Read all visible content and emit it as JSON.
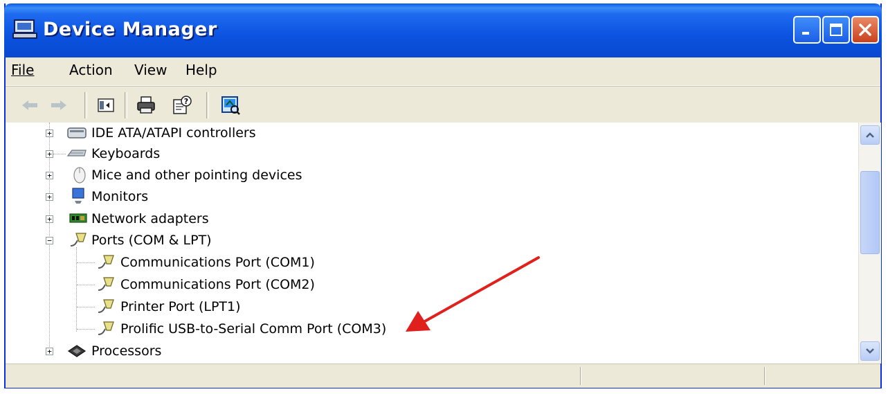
{
  "window": {
    "title": "Device Manager",
    "controls": {
      "minimize_icon": "minimize-icon",
      "maximize_icon": "maximize-icon",
      "close_icon": "close-icon"
    }
  },
  "menubar": {
    "items": [
      {
        "label": "File",
        "accesskey": "F"
      },
      {
        "label": "Action",
        "accesskey": "A"
      },
      {
        "label": "View",
        "accesskey": "V"
      },
      {
        "label": "Help",
        "accesskey": "H"
      }
    ]
  },
  "toolbar": {
    "items": [
      "back-arrow-icon",
      "forward-arrow-icon",
      "show-hide-console-tree-icon",
      "print-icon",
      "properties-help-icon",
      "scan-hardware-icon"
    ]
  },
  "tree": {
    "items": [
      {
        "label": "IDE ATA/ATAPI controllers",
        "icon": "ide-controller-icon",
        "expander": "+"
      },
      {
        "label": "Keyboards",
        "icon": "keyboard-icon",
        "expander": "+"
      },
      {
        "label": "Mice and other pointing devices",
        "icon": "mouse-icon",
        "expander": "+"
      },
      {
        "label": "Monitors",
        "icon": "monitor-icon",
        "expander": "+"
      },
      {
        "label": "Network adapters",
        "icon": "network-adapter-icon",
        "expander": "+"
      },
      {
        "label": "Ports (COM & LPT)",
        "icon": "port-icon",
        "expander": "−"
      },
      {
        "label": "Communications Port (COM1)",
        "icon": "port-icon"
      },
      {
        "label": "Communications Port (COM2)",
        "icon": "port-icon"
      },
      {
        "label": "Printer Port (LPT1)",
        "icon": "port-icon"
      },
      {
        "label": "Prolific USB-to-Serial Comm Port (COM3)",
        "icon": "port-icon"
      },
      {
        "label": "Processors",
        "icon": "processor-icon",
        "expander": "+"
      }
    ]
  },
  "annotation": {
    "arrow_color": "#e0201c"
  },
  "colors": {
    "titlebar": "#0b53e0",
    "chrome": "#ece9d8",
    "tree_bg": "#ffffff"
  }
}
